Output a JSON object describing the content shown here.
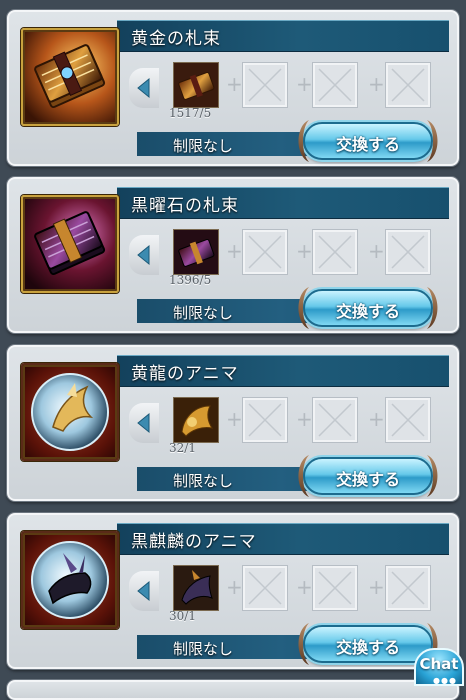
{
  "accent": "#1e5a78",
  "exchange_button_color": "#66c9ea",
  "items": [
    {
      "name": "黄金の札束",
      "icon": "gold-banknote-bundle-icon",
      "material_icon": "gold-treasure-icon",
      "quantity": "1517/5",
      "limit": "制限なし",
      "button": "交換する"
    },
    {
      "name": "黒曜石の札束",
      "icon": "obsidian-banknote-bundle-icon",
      "material_icon": "obsidian-treasure-icon",
      "quantity": "1396/5",
      "limit": "制限なし",
      "button": "交換する"
    },
    {
      "name": "黄龍のアニマ",
      "icon": "yellow-dragon-anima-orb-icon",
      "material_icon": "yellow-dragon-anima-material-icon",
      "quantity": "32/1",
      "limit": "制限なし",
      "button": "交換する"
    },
    {
      "name": "黒麒麟のアニマ",
      "icon": "black-kirin-anima-orb-icon",
      "material_icon": "black-kirin-anima-material-icon",
      "quantity": "30/1",
      "limit": "制限なし",
      "button": "交換する"
    }
  ],
  "chat": {
    "label": "Chat"
  }
}
